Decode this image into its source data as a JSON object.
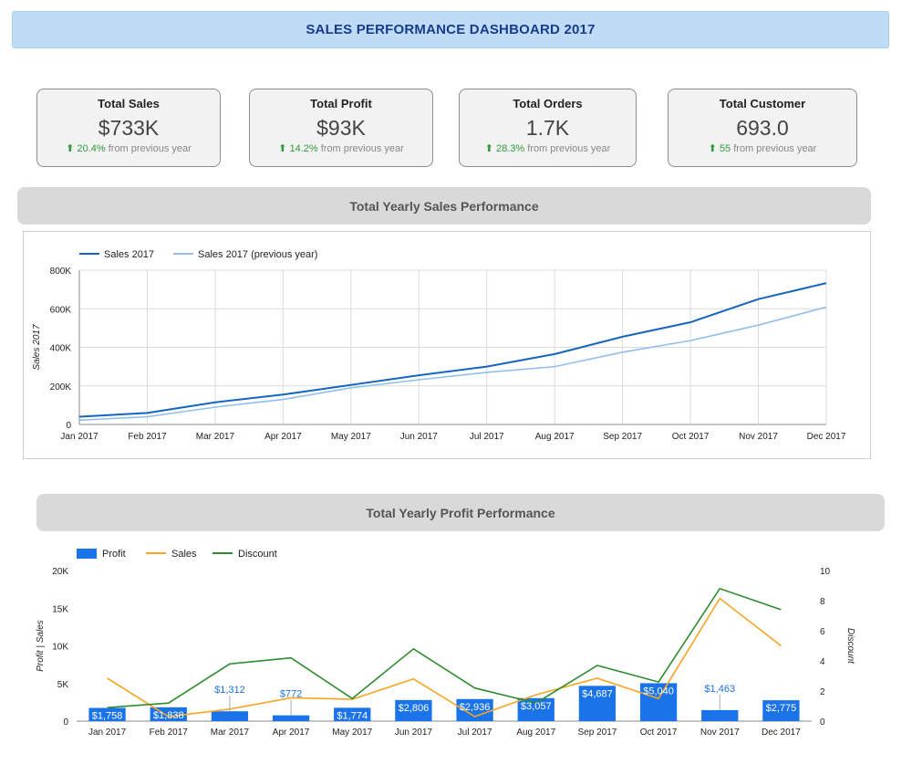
{
  "header": {
    "title": "SALES PERFORMANCE DASHBOARD 2017"
  },
  "kpis": [
    {
      "label": "Total Sales",
      "value": "$733K",
      "change": "20.4%",
      "suffix": "from previous year"
    },
    {
      "label": "Total Profit",
      "value": "$93K",
      "change": "14.2%",
      "suffix": "from previous year"
    },
    {
      "label": "Total Orders",
      "value": "1.7K",
      "change": "28.3%",
      "suffix": "from previous year"
    },
    {
      "label": "Total Customer",
      "value": "693.0",
      "change": "55",
      "suffix": "from previous year"
    }
  ],
  "colors": {
    "sales_line": "#1565c0",
    "prev_line": "#90bfee",
    "profit_bar": "#1a73e8",
    "sales_orange": "#f5a623",
    "discount_green": "#2e8b2e",
    "up_arrow": "#2e9a3c"
  },
  "sections": {
    "sales_title": "Total Yearly Sales Performance",
    "profit_title": "Total Yearly Profit Performance"
  },
  "chart_data": [
    {
      "type": "line",
      "title": "Total Yearly Sales Performance",
      "x": [
        "Jan 2017",
        "Feb 2017",
        "Mar 2017",
        "Apr 2017",
        "May 2017",
        "Jun 2017",
        "Jul 2017",
        "Aug 2017",
        "Sep 2017",
        "Oct 2017",
        "Nov 2017",
        "Dec 2017"
      ],
      "ylabel": "Sales 2017",
      "ylim": [
        0,
        800000
      ],
      "yticks": [
        "0",
        "200K",
        "400K",
        "600K",
        "800K"
      ],
      "yticks_values": [
        0,
        200000,
        400000,
        600000,
        800000
      ],
      "grid": true,
      "legend": "top-left",
      "series": [
        {
          "name": "Sales 2017",
          "values": [
            40000,
            60000,
            115000,
            155000,
            205000,
            255000,
            300000,
            365000,
            455000,
            530000,
            650000,
            733000
          ]
        },
        {
          "name": "Sales 2017 (previous year)",
          "values": [
            22000,
            40000,
            90000,
            130000,
            190000,
            232000,
            270000,
            300000,
            375000,
            435000,
            515000,
            609000
          ]
        }
      ]
    },
    {
      "type": "bar",
      "title": "Total Yearly Profit Performance",
      "categories": [
        "Jan 2017",
        "Feb 2017",
        "Mar 2017",
        "Apr 2017",
        "May 2017",
        "Jun 2017",
        "Jul 2017",
        "Aug 2017",
        "Sep 2017",
        "Oct 2017",
        "Nov 2017",
        "Dec 2017"
      ],
      "ylabel": "Profit | Sales",
      "ylim": [
        0,
        20000
      ],
      "yticks": [
        "0",
        "5K",
        "10K",
        "15K",
        "20K"
      ],
      "yticks_values": [
        0,
        5000,
        10000,
        15000,
        20000
      ],
      "y2label": "Discount",
      "y2lim": [
        0,
        10
      ],
      "y2ticks": [
        "0",
        "2",
        "4",
        "6",
        "8",
        "10"
      ],
      "y2ticks_values": [
        0,
        2,
        4,
        6,
        8,
        10
      ],
      "grid": false,
      "legend": "top-left",
      "series": [
        {
          "name": "Profit",
          "type": "bar",
          "axis": "left",
          "values": [
            1758,
            1838,
            1312,
            772,
            1774,
            2806,
            2936,
            3057,
            4687,
            5040,
            1463,
            2775
          ],
          "labels": [
            "$1,758",
            "$1,838",
            "$1,312",
            "$772",
            "$1,774",
            "$2,806",
            "$2,936",
            "$3,057",
            "$4,687",
            "$5,040",
            "$1,463",
            "$2,775"
          ]
        },
        {
          "name": "Sales",
          "type": "line",
          "axis": "left",
          "values": [
            5700,
            600,
            1600,
            3100,
            2900,
            5600,
            600,
            3500,
            5700,
            3000,
            16300,
            10000
          ]
        },
        {
          "name": "Discount",
          "type": "line",
          "axis": "right",
          "values": [
            0.9,
            1.2,
            3.8,
            4.2,
            1.5,
            4.8,
            2.2,
            1.2,
            3.7,
            2.6,
            8.8,
            7.4
          ]
        }
      ]
    }
  ]
}
